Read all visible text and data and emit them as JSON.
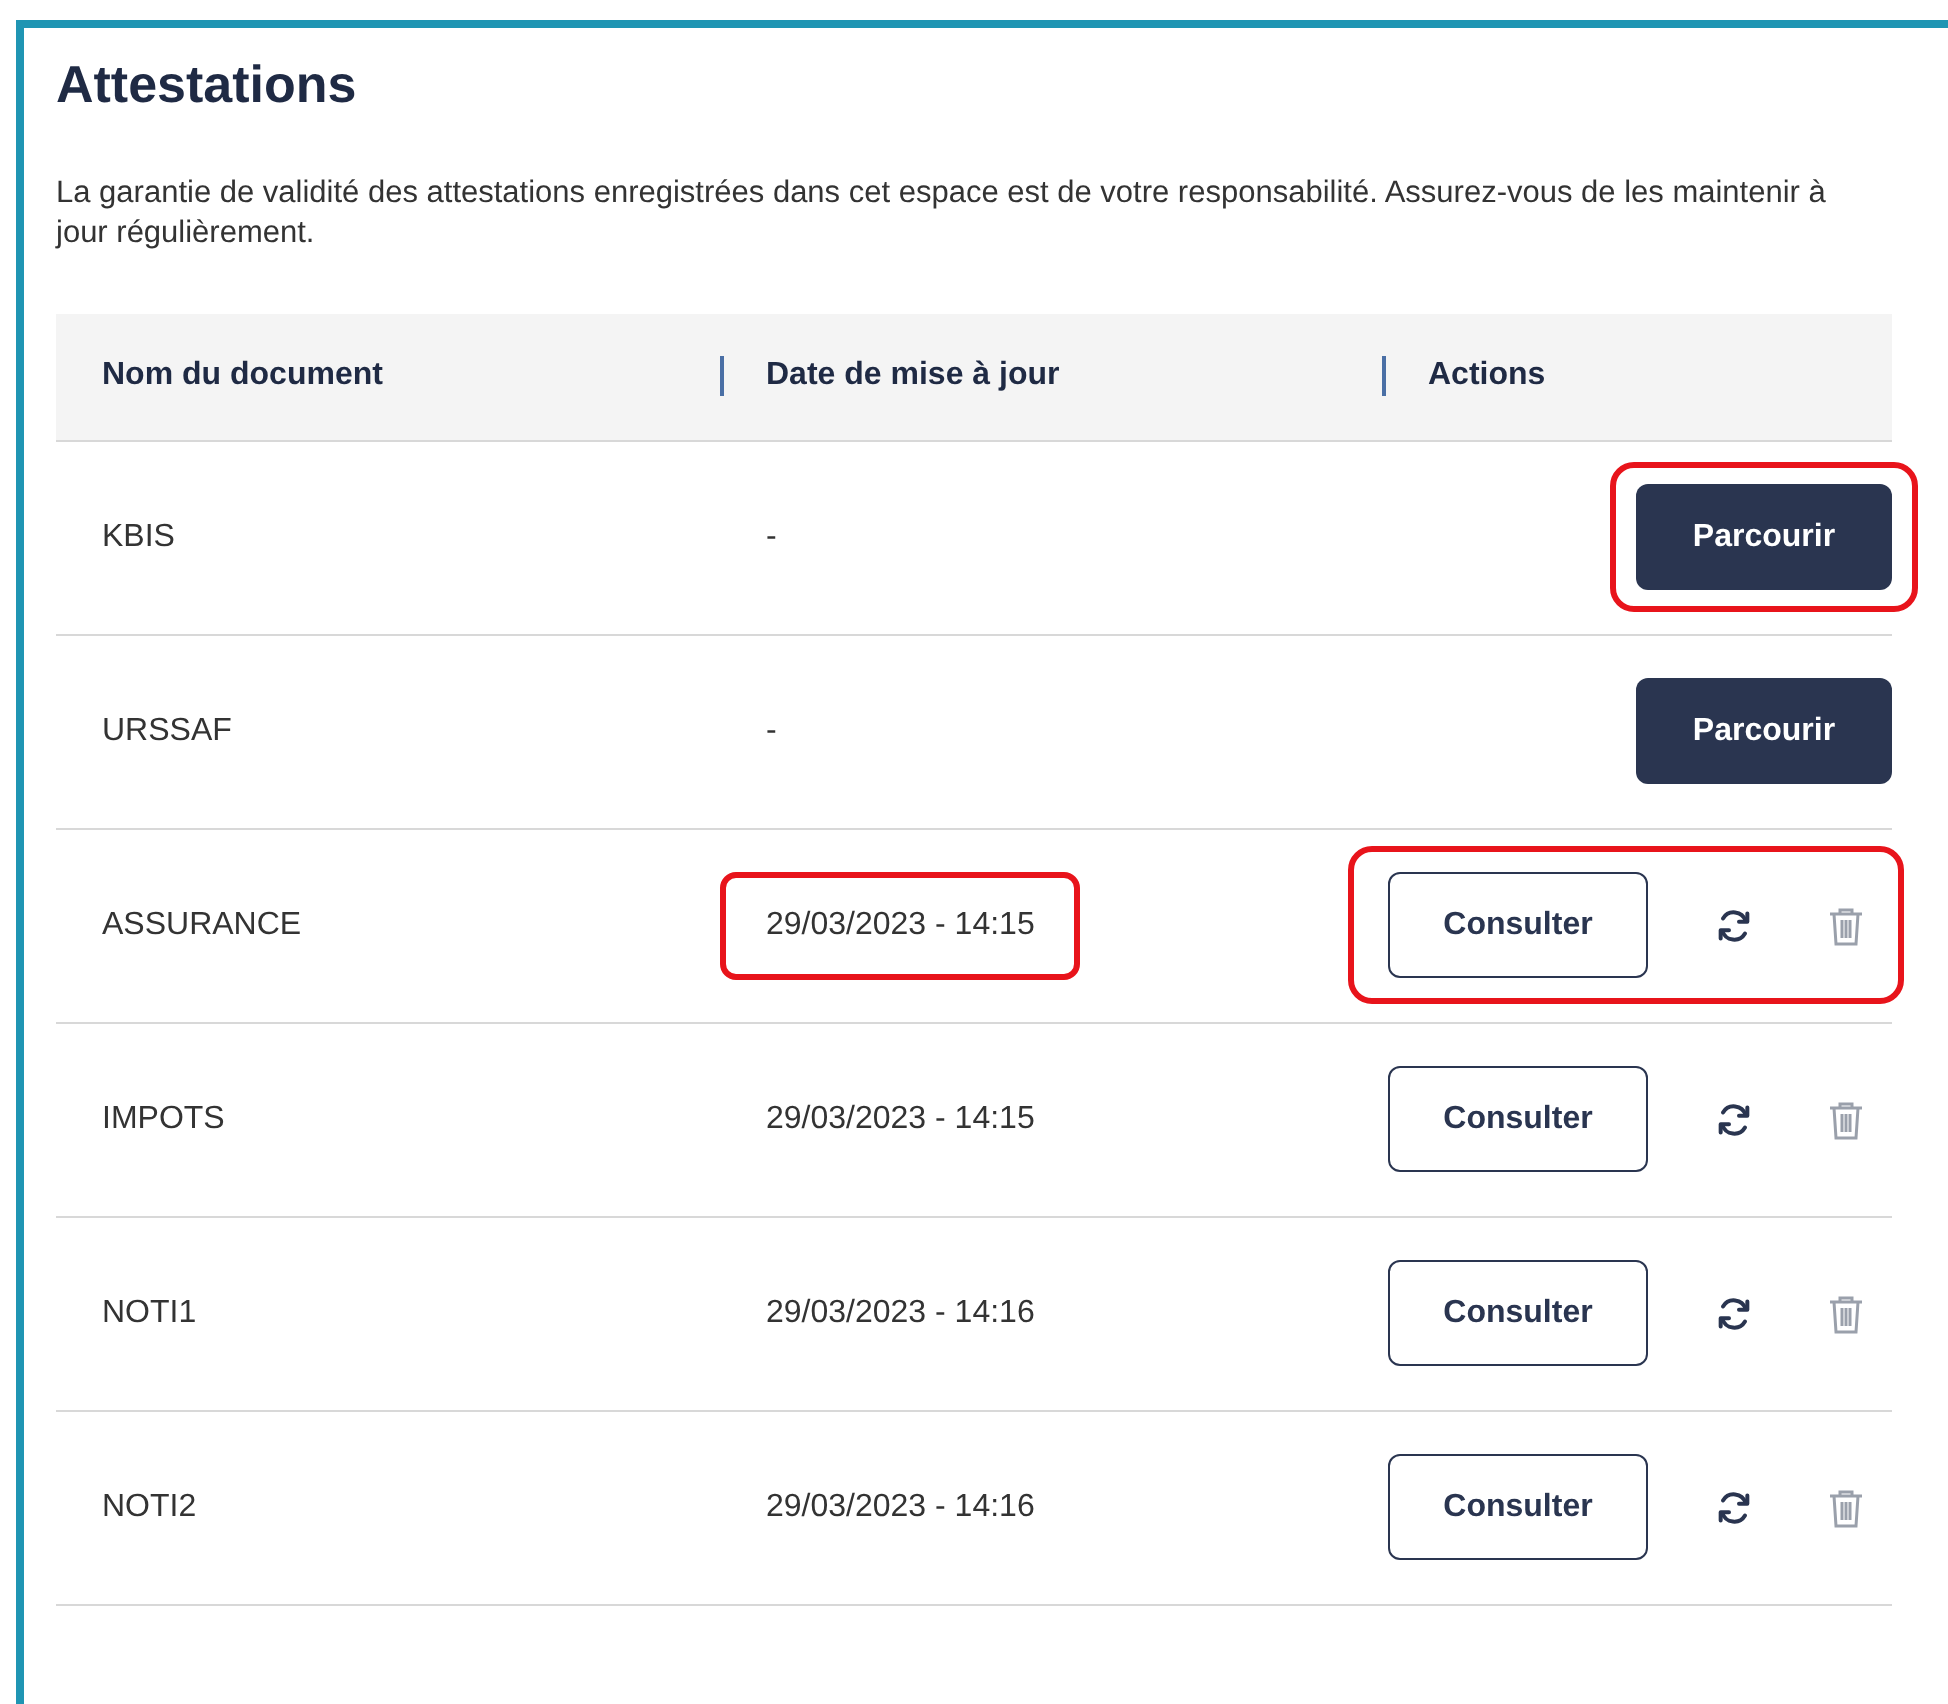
{
  "title": "Attestations",
  "notice": "La garantie de validité des attestations enregistrées dans cet espace est de votre responsabilité. Assurez-vous de les maintenir à jour régulièrement.",
  "table": {
    "columns": [
      "Nom du document",
      "Date de mise à jour",
      "Actions"
    ],
    "rows": [
      {
        "name": "KBIS",
        "date": "-",
        "kind": "upload",
        "button": "Parcourir",
        "date_highlighted": false,
        "actions_highlighted": true
      },
      {
        "name": "URSSAF",
        "date": "-",
        "kind": "upload",
        "button": "Parcourir",
        "date_highlighted": false,
        "actions_highlighted": false
      },
      {
        "name": "ASSURANCE",
        "date": "29/03/2023 - 14:15",
        "kind": "view",
        "button": "Consulter",
        "date_highlighted": true,
        "actions_highlighted": true
      },
      {
        "name": "IMPOTS",
        "date": "29/03/2023 - 14:15",
        "kind": "view",
        "button": "Consulter",
        "date_highlighted": false,
        "actions_highlighted": false
      },
      {
        "name": "NOTI1",
        "date": "29/03/2023 - 14:16",
        "kind": "view",
        "button": "Consulter",
        "date_highlighted": false,
        "actions_highlighted": false
      },
      {
        "name": "NOTI2",
        "date": "29/03/2023 - 14:16",
        "kind": "view",
        "button": "Consulter",
        "date_highlighted": false,
        "actions_highlighted": false
      }
    ]
  }
}
